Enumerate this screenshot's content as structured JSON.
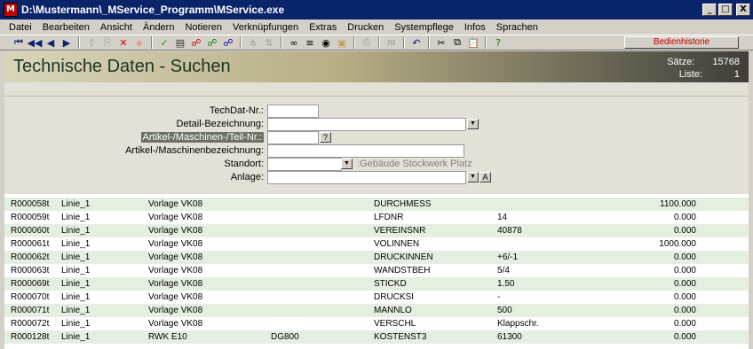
{
  "window": {
    "title": "D:\\Mustermann\\_MService_Programm\\MService.exe",
    "minimize": "_",
    "maximize": "□",
    "close": "X"
  },
  "menu": [
    "Datei",
    "Bearbeiten",
    "Ansicht",
    "Ändern",
    "Notieren",
    "Verknüpfungen",
    "Extras",
    "Drucken",
    "Systempflege",
    "Infos",
    "Sprachen"
  ],
  "toolbar": {
    "buttons": [
      {
        "name": "first-record-icon",
        "glyph": "⏮",
        "color": "#0a246a"
      },
      {
        "name": "prev-page-icon",
        "glyph": "◀◀",
        "color": "#0a246a"
      },
      {
        "name": "prev-record-icon",
        "glyph": "◀",
        "color": "#0a246a"
      },
      {
        "name": "next-record-icon",
        "glyph": "▶",
        "color": "#0a246a"
      },
      {
        "name": "sep"
      },
      {
        "name": "export-icon",
        "glyph": "⇪",
        "color": "#a0a0a0"
      },
      {
        "name": "copy-record-icon",
        "glyph": "⎘",
        "color": "#a0a0a0"
      },
      {
        "name": "delete-icon",
        "glyph": "✕",
        "color": "#e00000"
      },
      {
        "name": "eraser-icon",
        "glyph": "◆",
        "color": "#e8a0a0"
      },
      {
        "name": "sep"
      },
      {
        "name": "confirm-icon",
        "glyph": "✓",
        "color": "#00a000"
      },
      {
        "name": "calculator-icon",
        "glyph": "▤",
        "color": "#303030"
      },
      {
        "name": "link-red-icon",
        "glyph": "☍",
        "color": "#c00000"
      },
      {
        "name": "link-green-icon",
        "glyph": "☍",
        "color": "#008000"
      },
      {
        "name": "link-blue-icon",
        "glyph": "☍",
        "color": "#0000a0"
      },
      {
        "name": "sep"
      },
      {
        "name": "branch-icon",
        "glyph": "⋔",
        "color": "#a0a0a0"
      },
      {
        "name": "sort-icon",
        "glyph": "⇅",
        "color": "#a0a0a0"
      },
      {
        "name": "sep"
      },
      {
        "name": "binoculars-icon",
        "glyph": "∞",
        "color": "#000000"
      },
      {
        "name": "list-icon",
        "glyph": "≡",
        "color": "#000000"
      },
      {
        "name": "view-icon",
        "glyph": "◉",
        "color": "#000000"
      },
      {
        "name": "image-icon",
        "glyph": "▣",
        "color": "#c0a060"
      },
      {
        "name": "sep"
      },
      {
        "name": "print-icon",
        "glyph": "⎙",
        "color": "#a0a0a0"
      },
      {
        "name": "sep"
      },
      {
        "name": "mail-icon",
        "glyph": "✉",
        "color": "#a0a0a0"
      },
      {
        "name": "sep"
      },
      {
        "name": "undo-icon",
        "glyph": "↶",
        "color": "#0a246a"
      },
      {
        "name": "sep"
      },
      {
        "name": "cut-icon",
        "glyph": "✂",
        "color": "#000000"
      },
      {
        "name": "copy-icon",
        "glyph": "⧉",
        "color": "#000000"
      },
      {
        "name": "paste-icon",
        "glyph": "📋",
        "color": "#000000"
      },
      {
        "name": "sep"
      },
      {
        "name": "help-icon",
        "glyph": "?",
        "color": "#008000"
      }
    ]
  },
  "bedienhistorie_label": "Bedienhistorie",
  "header": {
    "title": "Technische Daten  -  Suchen",
    "stats": [
      {
        "label": "Sätze:",
        "value": "15768"
      },
      {
        "label": "Liste:",
        "value": "1"
      }
    ]
  },
  "form": {
    "techdat_label": "TechDat-Nr.:",
    "detail_label": "Detail-Bezeichnung:",
    "artikel_nr_label": "Artikel-/Maschinen-/Teil-Nr.:",
    "artikel_nr_btn": "?",
    "artikel_bez_label": "Artikel-/Maschinenbezeichnung:",
    "standort_label": "Standort:",
    "standort_hint": ":Gebäude Stockwerk Platz",
    "anlage_label": "Anlage:",
    "anlage_btn": "A",
    "techdat_value": "",
    "detail_value": "",
    "artikel_nr_value": "",
    "artikel_bez_value": "",
    "standort_value": "",
    "anlage_value": ""
  },
  "list": {
    "rows": [
      {
        "id": "R000058t",
        "linie": "Linie_1",
        "vorlage": "Vorlage VK08",
        "extra": "",
        "param": "DURCHMESS",
        "wert": "",
        "zahl": "1100.000"
      },
      {
        "id": "R000059t",
        "linie": "Linie_1",
        "vorlage": "Vorlage VK08",
        "extra": "",
        "param": "LFDNR",
        "wert": "14",
        "zahl": "0.000"
      },
      {
        "id": "R000060t",
        "linie": "Linie_1",
        "vorlage": "Vorlage VK08",
        "extra": "",
        "param": "VEREINSNR",
        "wert": "40878",
        "zahl": "0.000"
      },
      {
        "id": "R000061t",
        "linie": "Linie_1",
        "vorlage": "Vorlage VK08",
        "extra": "",
        "param": "VOLINNEN",
        "wert": "",
        "zahl": "1000.000"
      },
      {
        "id": "R000062t",
        "linie": "Linie_1",
        "vorlage": "Vorlage VK08",
        "extra": "",
        "param": "DRUCKINNEN",
        "wert": "+6/-1",
        "zahl": "0.000"
      },
      {
        "id": "R000063t",
        "linie": "Linie_1",
        "vorlage": "Vorlage VK08",
        "extra": "",
        "param": "WANDSTBEH",
        "wert": "5/4",
        "zahl": "0.000"
      },
      {
        "id": "R000069t",
        "linie": "Linie_1",
        "vorlage": "Vorlage VK08",
        "extra": "",
        "param": "STICKD",
        "wert": "1.50",
        "zahl": "0.000"
      },
      {
        "id": "R000070t",
        "linie": "Linie_1",
        "vorlage": "Vorlage VK08",
        "extra": "",
        "param": "DRUCKSI",
        "wert": "-",
        "zahl": "0.000"
      },
      {
        "id": "R000071t",
        "linie": "Linie_1",
        "vorlage": "Vorlage VK08",
        "extra": "",
        "param": "MANNLO",
        "wert": "500",
        "zahl": "0.000"
      },
      {
        "id": "R000072t",
        "linie": "Linie_1",
        "vorlage": "Vorlage VK08",
        "extra": "",
        "param": "VERSCHL",
        "wert": "Klappschr.",
        "zahl": "0.000"
      },
      {
        "id": "R000128t",
        "linie": "Linie_1",
        "vorlage": "RWK E10",
        "extra": "DG800",
        "param": "KOSTENST3",
        "wert": "61300",
        "zahl": "0.000"
      }
    ]
  }
}
